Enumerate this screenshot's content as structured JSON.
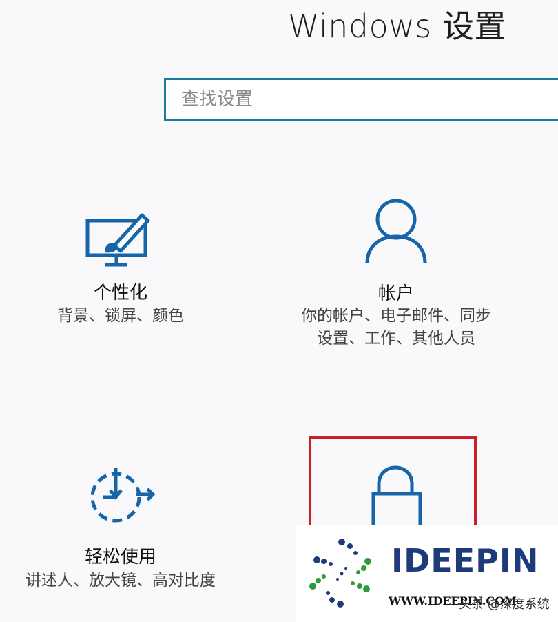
{
  "window": {
    "title": "Windows 设置"
  },
  "search": {
    "placeholder": "查找设置"
  },
  "tiles": [
    {
      "name": "个性化",
      "desc": [
        "背景、锁屏、颜色"
      ],
      "icon": "personalization-icon"
    },
    {
      "name": "帐户",
      "desc": [
        "你的帐户、电子邮件、同步",
        "设置、工作、其他人员"
      ],
      "icon": "account-icon"
    },
    {
      "name": "轻松使用",
      "desc": [
        "讲述人、放大镜、高对比度"
      ],
      "icon": "ease-of-access-icon"
    },
    {
      "name": "",
      "desc": [],
      "icon": "lock-icon"
    }
  ],
  "watermark": {
    "brand": "IDEEPIN",
    "url": "WWW.IDEEPIN.COM",
    "tag": "头条 @深度系统"
  },
  "colors": {
    "accent": "#1d7a9a",
    "icon": "#1565a8",
    "highlight": "#c8202a"
  }
}
